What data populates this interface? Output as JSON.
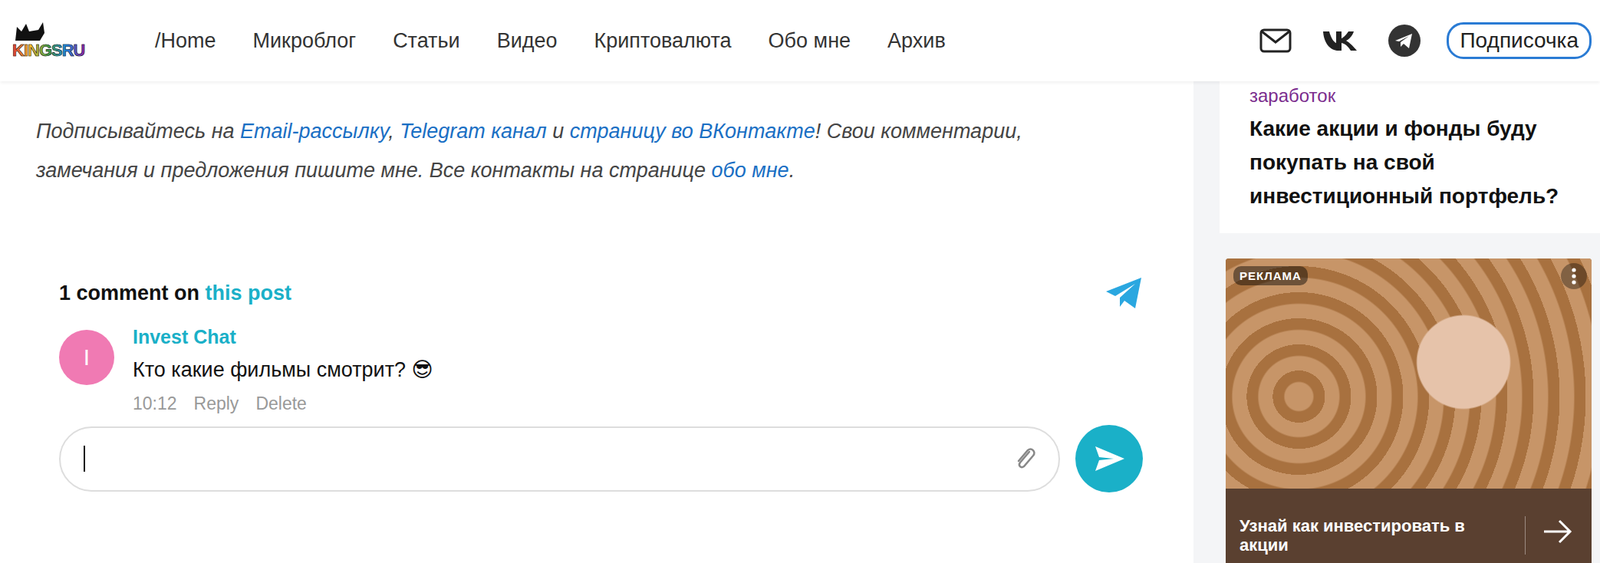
{
  "header": {
    "logo": "KINGSRU",
    "nav": [
      {
        "label": "/Home",
        "selected": false
      },
      {
        "label": "Микроблог",
        "selected": false
      },
      {
        "label": "Статьи",
        "selected": false
      },
      {
        "label": "Видео",
        "selected": false
      },
      {
        "label": "Криптовалюта",
        "selected": false
      },
      {
        "label": "Обо мне",
        "selected": false
      },
      {
        "label": "Архив",
        "selected": false
      }
    ],
    "subscribe": "Подписочка"
  },
  "notice": [
    {
      "text": "Подписывайтесь на ",
      "link": false
    },
    {
      "text": "Email-рассылку",
      "link": true
    },
    {
      "text": ", ",
      "link": false
    },
    {
      "text": "Telegram канал",
      "link": true
    },
    {
      "text": " и ",
      "link": false
    },
    {
      "text": "страницу во ВКонтакте",
      "link": true
    },
    {
      "text": "! Свои комментарии, замечания и предложения пишите мне. Все контакты на странице ",
      "link": false
    },
    {
      "text": "обо мне",
      "link": true
    },
    {
      "text": ".",
      "link": false
    }
  ],
  "comments": {
    "count_text": "1 comment on ",
    "post_link": "this post",
    "items": [
      {
        "avatar": "I",
        "color": "#f07ab3",
        "author": "Invest Chat",
        "text": "Кто какие фильмы смотрит? 😎",
        "time": "10:12",
        "actions": [
          "Reply",
          "Delete"
        ]
      }
    ],
    "input": {
      "value": ""
    }
  },
  "sidebar": {
    "post": {
      "category": "заработок",
      "title": "Какие акции и фонды буду покупать на свой инвестиционный портфель?"
    },
    "ad": {
      "badge": "РЕКЛАМА",
      "caption": "Узнай как инвестировать в акции"
    }
  }
}
